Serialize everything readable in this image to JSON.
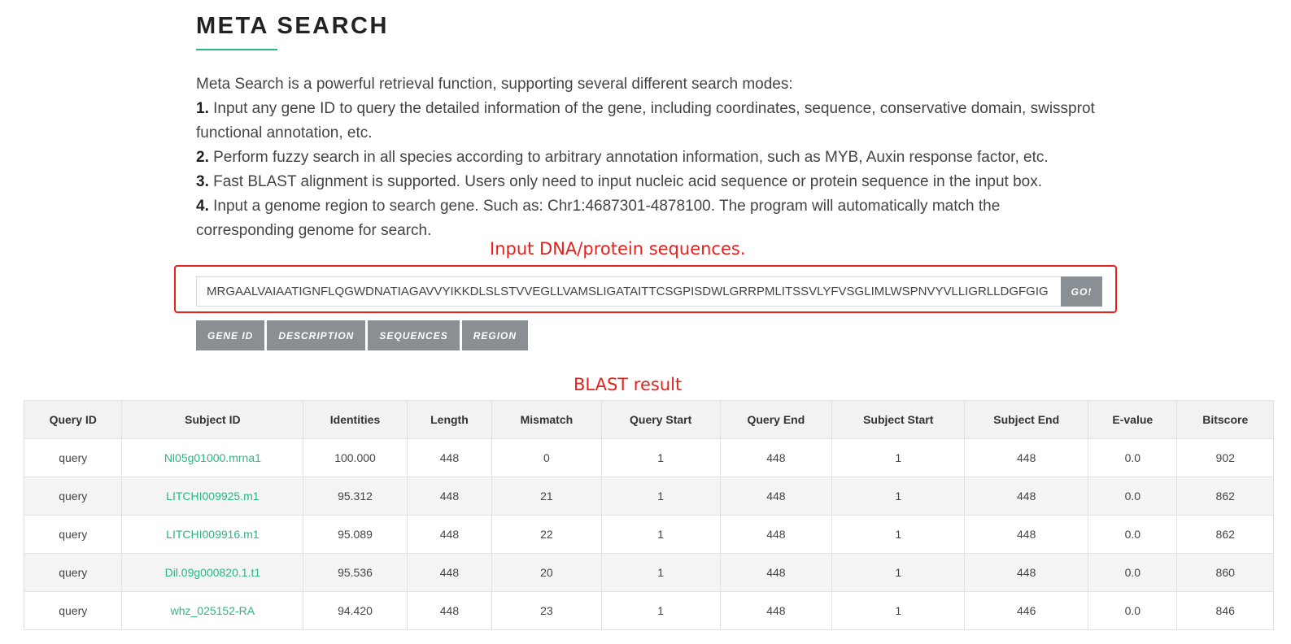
{
  "page": {
    "title": "META SEARCH",
    "accent_color": "#2ab685",
    "annotation_color": "#e8201c"
  },
  "intro": {
    "lead": "Meta Search is a powerful retrieval function, supporting several different search modes:",
    "items": [
      {
        "num": "1.",
        "text": " Input any gene ID to query the detailed information of the gene, including coordinates, sequence, conservative domain, swissprot functional annotation, etc."
      },
      {
        "num": "2.",
        "text": " Perform fuzzy search in all species according to arbitrary annotation information, such as MYB, Auxin response factor, etc."
      },
      {
        "num": "3.",
        "text": " Fast BLAST alignment is supported. Users only need to input nucleic acid sequence or protein sequence in the input box."
      },
      {
        "num": "4.",
        "text": " Input a genome region to search gene. Such as: Chr1:4687301-4878100. The program will automatically match the corresponding genome for search."
      }
    ]
  },
  "annotations": {
    "input_label": "Input DNA/protein sequences.",
    "result_label": "BLAST result"
  },
  "search": {
    "value": "MRGAALVAIAATIGNFLQGWDNATIAGAVVYIKKDLSLSTVVEGLLVAMSLIGATAITTCSGPISDWLGRRPMLITSSVLYFVSGLIMLWSPNVYVLLIGRLLDGFGIG",
    "go_label": "GO!"
  },
  "modes": [
    "GENE ID",
    "DESCRIPTION",
    "SEQUENCES",
    "REGION"
  ],
  "table": {
    "headers": [
      "Query ID",
      "Subject ID",
      "Identities",
      "Length",
      "Mismatch",
      "Query Start",
      "Query End",
      "Subject Start",
      "Subject End",
      "E-value",
      "Bitscore"
    ],
    "rows": [
      [
        "query",
        "Nl05g01000.mrna1",
        "100.000",
        "448",
        "0",
        "1",
        "448",
        "1",
        "448",
        "0.0",
        "902"
      ],
      [
        "query",
        "LITCHI009925.m1",
        "95.312",
        "448",
        "21",
        "1",
        "448",
        "1",
        "448",
        "0.0",
        "862"
      ],
      [
        "query",
        "LITCHI009916.m1",
        "95.089",
        "448",
        "22",
        "1",
        "448",
        "1",
        "448",
        "0.0",
        "862"
      ],
      [
        "query",
        "Dil.09g000820.1.t1",
        "95.536",
        "448",
        "20",
        "1",
        "448",
        "1",
        "448",
        "0.0",
        "860"
      ],
      [
        "query",
        "whz_025152-RA",
        "94.420",
        "448",
        "23",
        "1",
        "448",
        "1",
        "446",
        "0.0",
        "846"
      ]
    ]
  }
}
